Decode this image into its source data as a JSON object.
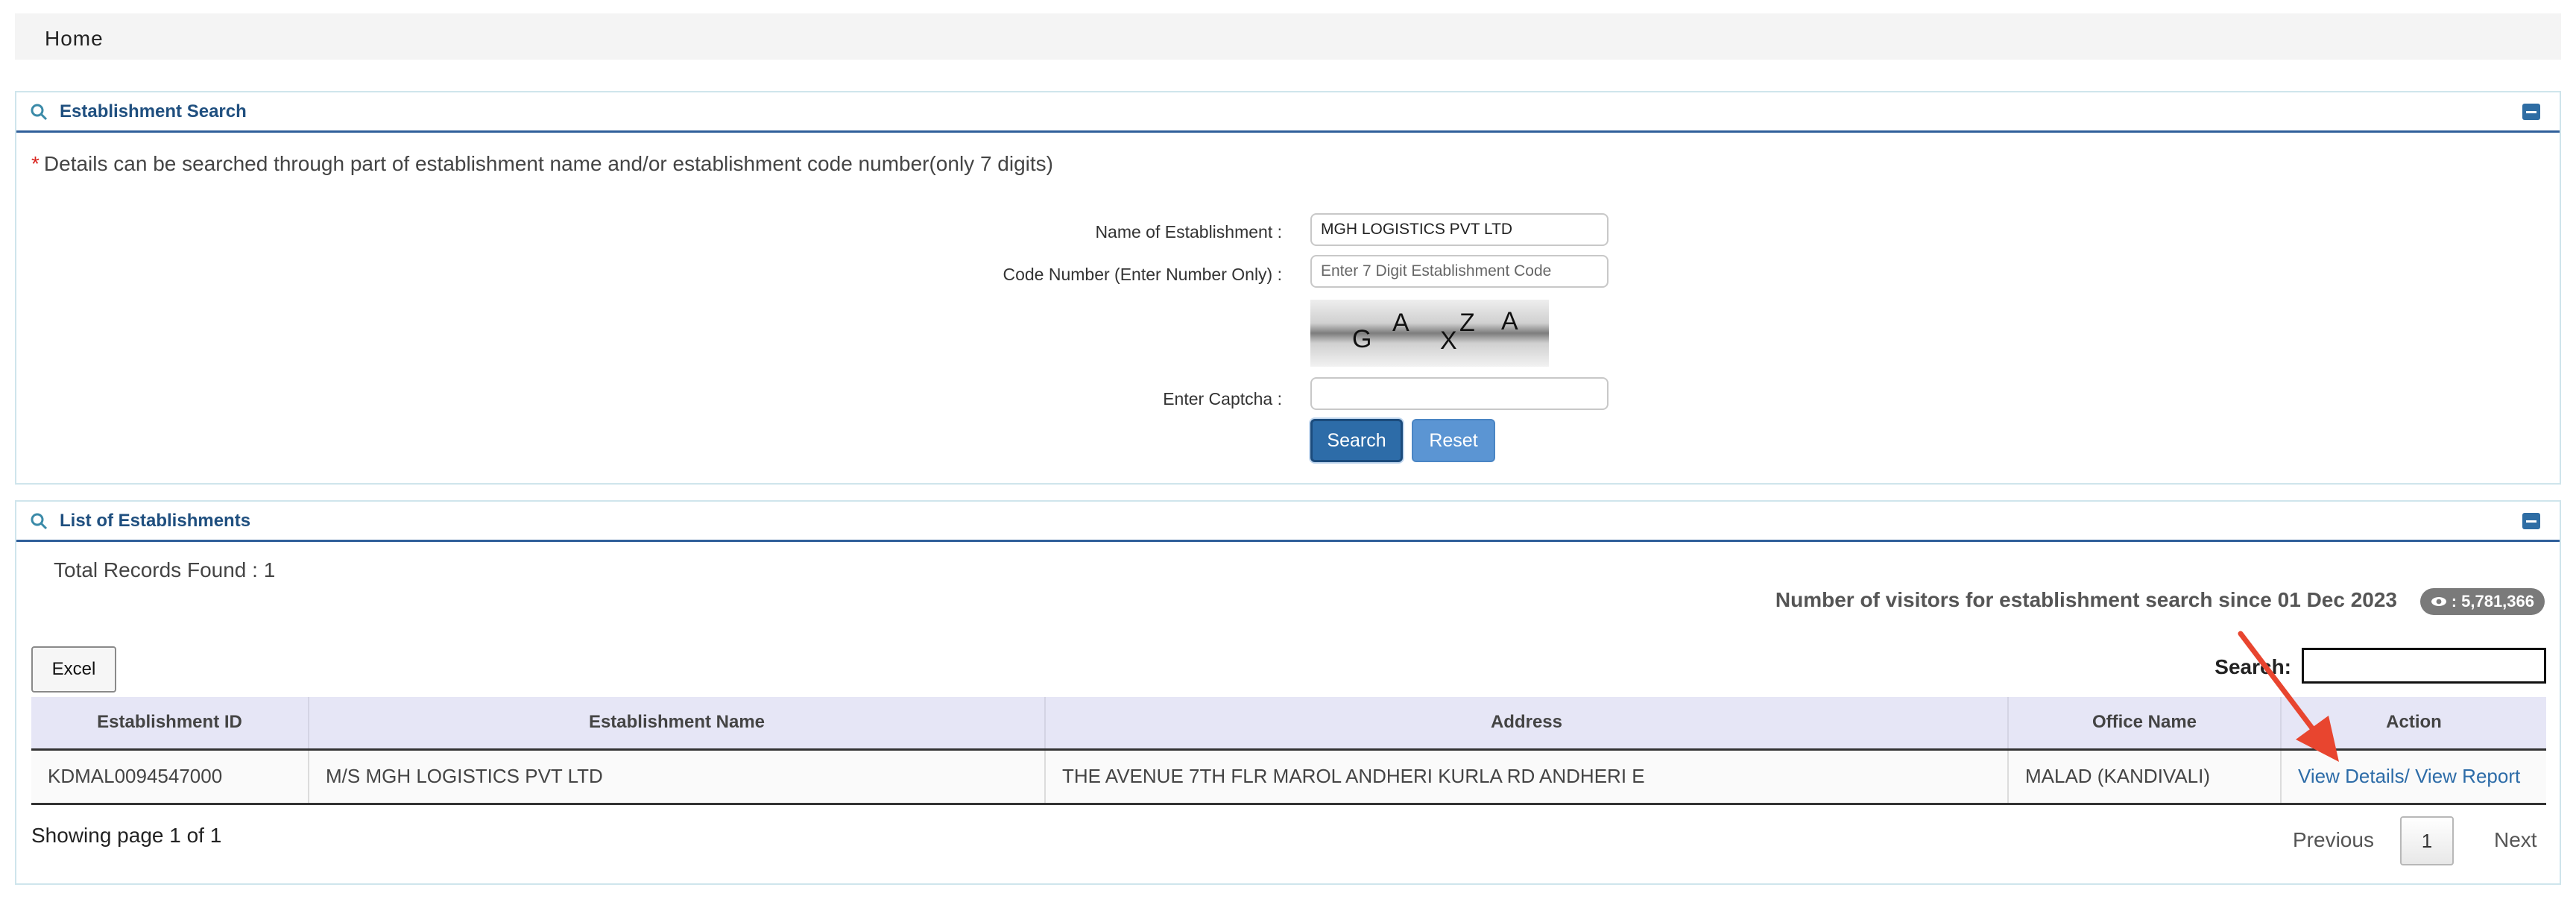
{
  "nav": {
    "home": "Home"
  },
  "search_panel": {
    "title": "Establishment Search",
    "note_star": "*",
    "note": "Details can be searched through part of establishment name and/or establishment code number(only 7 digits)",
    "name_label": "Name of Establishment :",
    "name_value": "MGH LOGISTICS PVT LTD",
    "code_label": "Code Number (Enter Number Only) :",
    "code_placeholder": "Enter 7 Digit Establishment Code",
    "captcha_chars": [
      "G",
      "A",
      "X",
      "Z",
      "A"
    ],
    "captcha_label": "Enter Captcha :",
    "captcha_value": "",
    "search_button": "Search",
    "reset_button": "Reset"
  },
  "list_panel": {
    "title": "List of Establishments",
    "total_records": "Total Records Found : 1",
    "visitors_text": "Number of visitors for establishment search since 01 Dec 2023",
    "visitors_count": ": 5,781,366",
    "excel_button": "Excel",
    "search_label": "Search:",
    "columns": [
      "Establishment ID",
      "Establishment Name",
      "Address",
      "Office Name",
      "Action"
    ],
    "rows": [
      {
        "id": "KDMAL0094547000",
        "name": "M/S MGH LOGISTICS PVT LTD",
        "address": "THE AVENUE 7TH FLR MAROL ANDHERI KURLA RD ANDHERI E",
        "office": "MALAD (KANDIVALI)",
        "view_details": "View Details",
        "separator": "/",
        "view_report": "View Report"
      }
    ],
    "showing": "Showing page 1 of 1",
    "pagination": {
      "previous": "Previous",
      "current": "1",
      "next": "Next"
    }
  },
  "colors": {
    "accent": "#2d6ca8",
    "annotation_arrow": "#e8452f"
  }
}
